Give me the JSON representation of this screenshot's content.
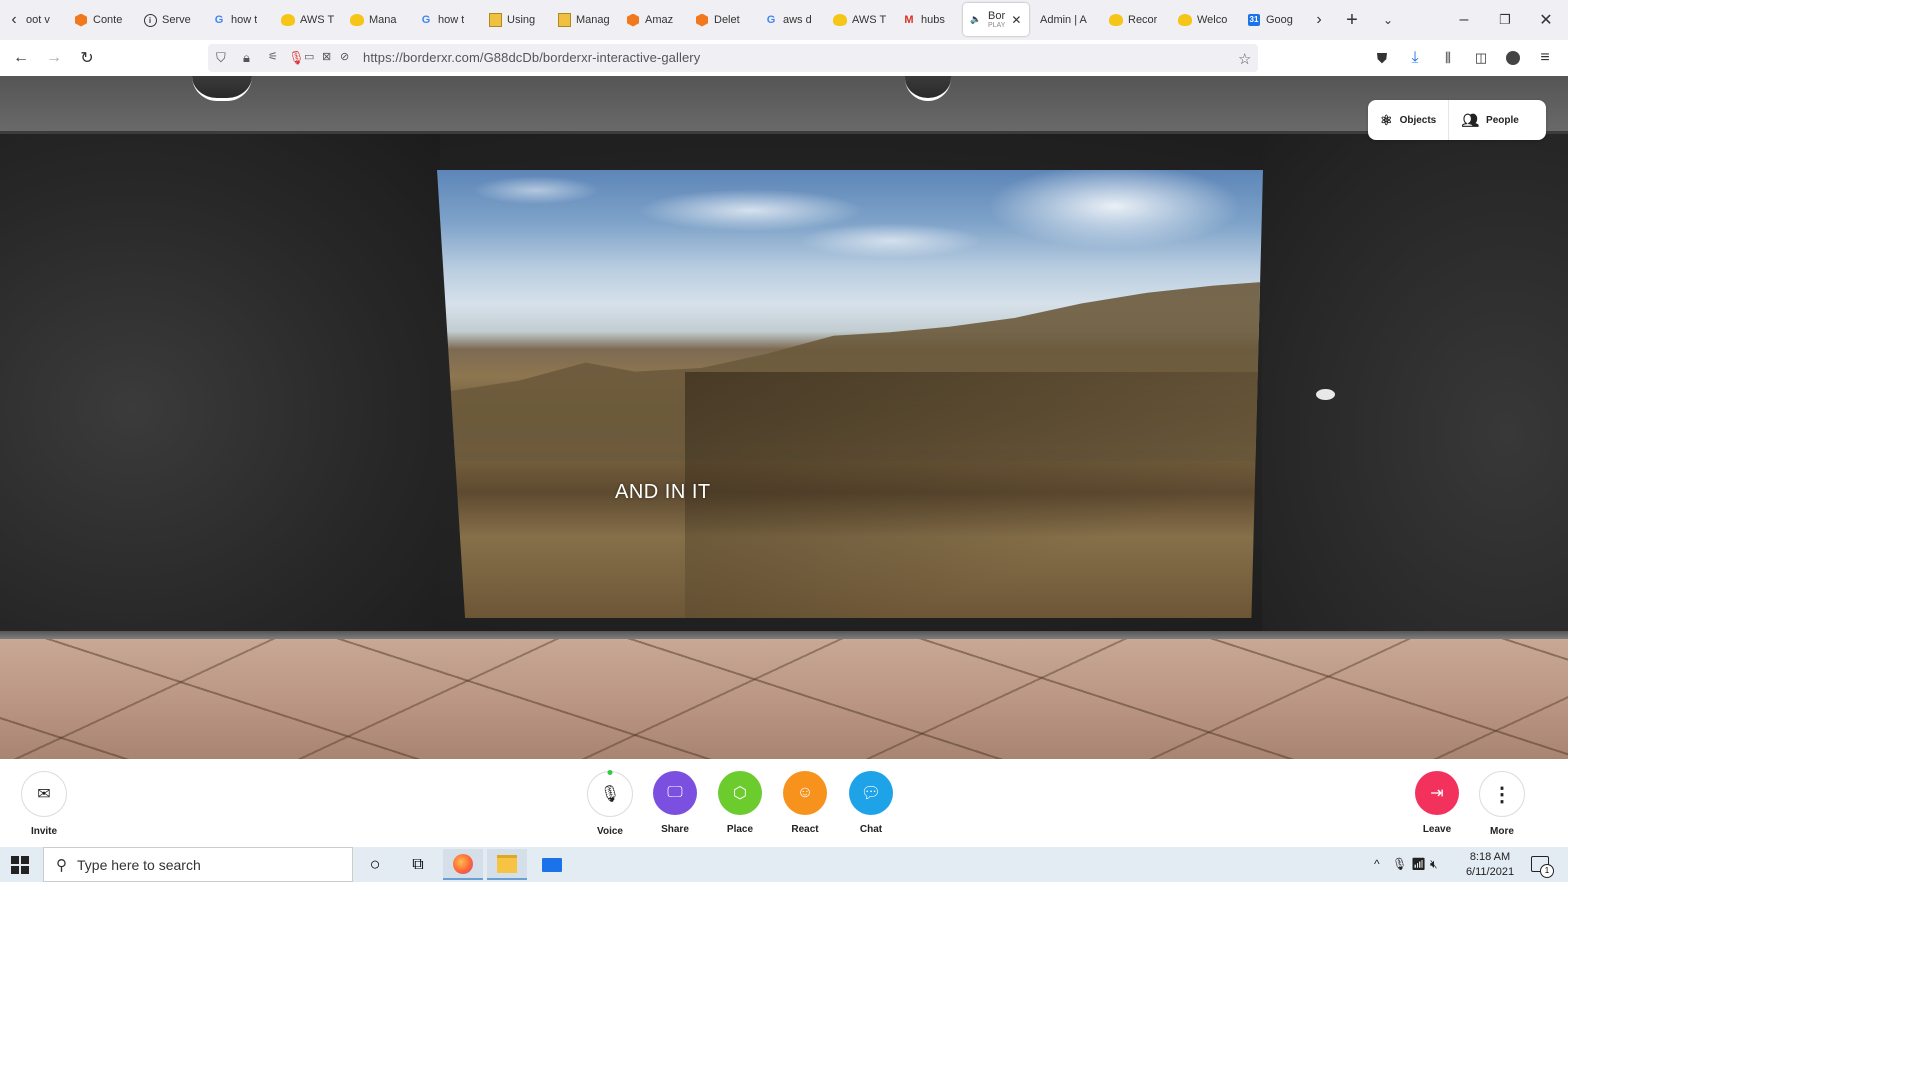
{
  "browser": {
    "tabs": [
      {
        "label": "oot v",
        "icon": "none"
      },
      {
        "label": "Conte",
        "icon": "aws-icon"
      },
      {
        "label": "Serve",
        "icon": "info-icon"
      },
      {
        "label": "how t",
        "icon": "google-icon"
      },
      {
        "label": "AWS T",
        "icon": "hubs-icon"
      },
      {
        "label": "Mana",
        "icon": "hubs-icon"
      },
      {
        "label": "how t",
        "icon": "google-icon"
      },
      {
        "label": "Using",
        "icon": "docs-icon"
      },
      {
        "label": "Manag",
        "icon": "docs-icon"
      },
      {
        "label": "Amaz",
        "icon": "aws-icon"
      },
      {
        "label": "Delet",
        "icon": "aws-icon"
      },
      {
        "label": "aws d",
        "icon": "google-icon"
      },
      {
        "label": "AWS T",
        "icon": "hubs-icon"
      },
      {
        "label": "hubs",
        "icon": "gmail-icon"
      },
      {
        "label": "Bor",
        "sub": "PLAY",
        "icon": "speaker-icon",
        "active": true
      },
      {
        "label": "Admin | A",
        "icon": "none"
      },
      {
        "label": "Recor",
        "icon": "hubs-icon"
      },
      {
        "label": "Welco",
        "icon": "hubs-icon"
      },
      {
        "label": "Goog",
        "icon": "calendar-icon"
      }
    ],
    "url": "https://borderxr.com/G88dcDb/borderxr-interactive-gallery"
  },
  "scene": {
    "caption": "AND IN IT",
    "top_buttons": {
      "objects": "Objects",
      "people": "People"
    }
  },
  "toolbar": {
    "invite": "Invite",
    "voice": "Voice",
    "share": "Share",
    "place": "Place",
    "react": "React",
    "chat": "Chat",
    "leave": "Leave",
    "more": "More",
    "colors": {
      "share": "#7b4fe0",
      "place": "#6ccc2e",
      "react": "#f7921c",
      "chat": "#1ea2e8",
      "leave": "#f2325c"
    }
  },
  "taskbar": {
    "search_placeholder": "Type here to search",
    "time": "8:18 AM",
    "date": "6/11/2021",
    "notification_count": "1"
  }
}
